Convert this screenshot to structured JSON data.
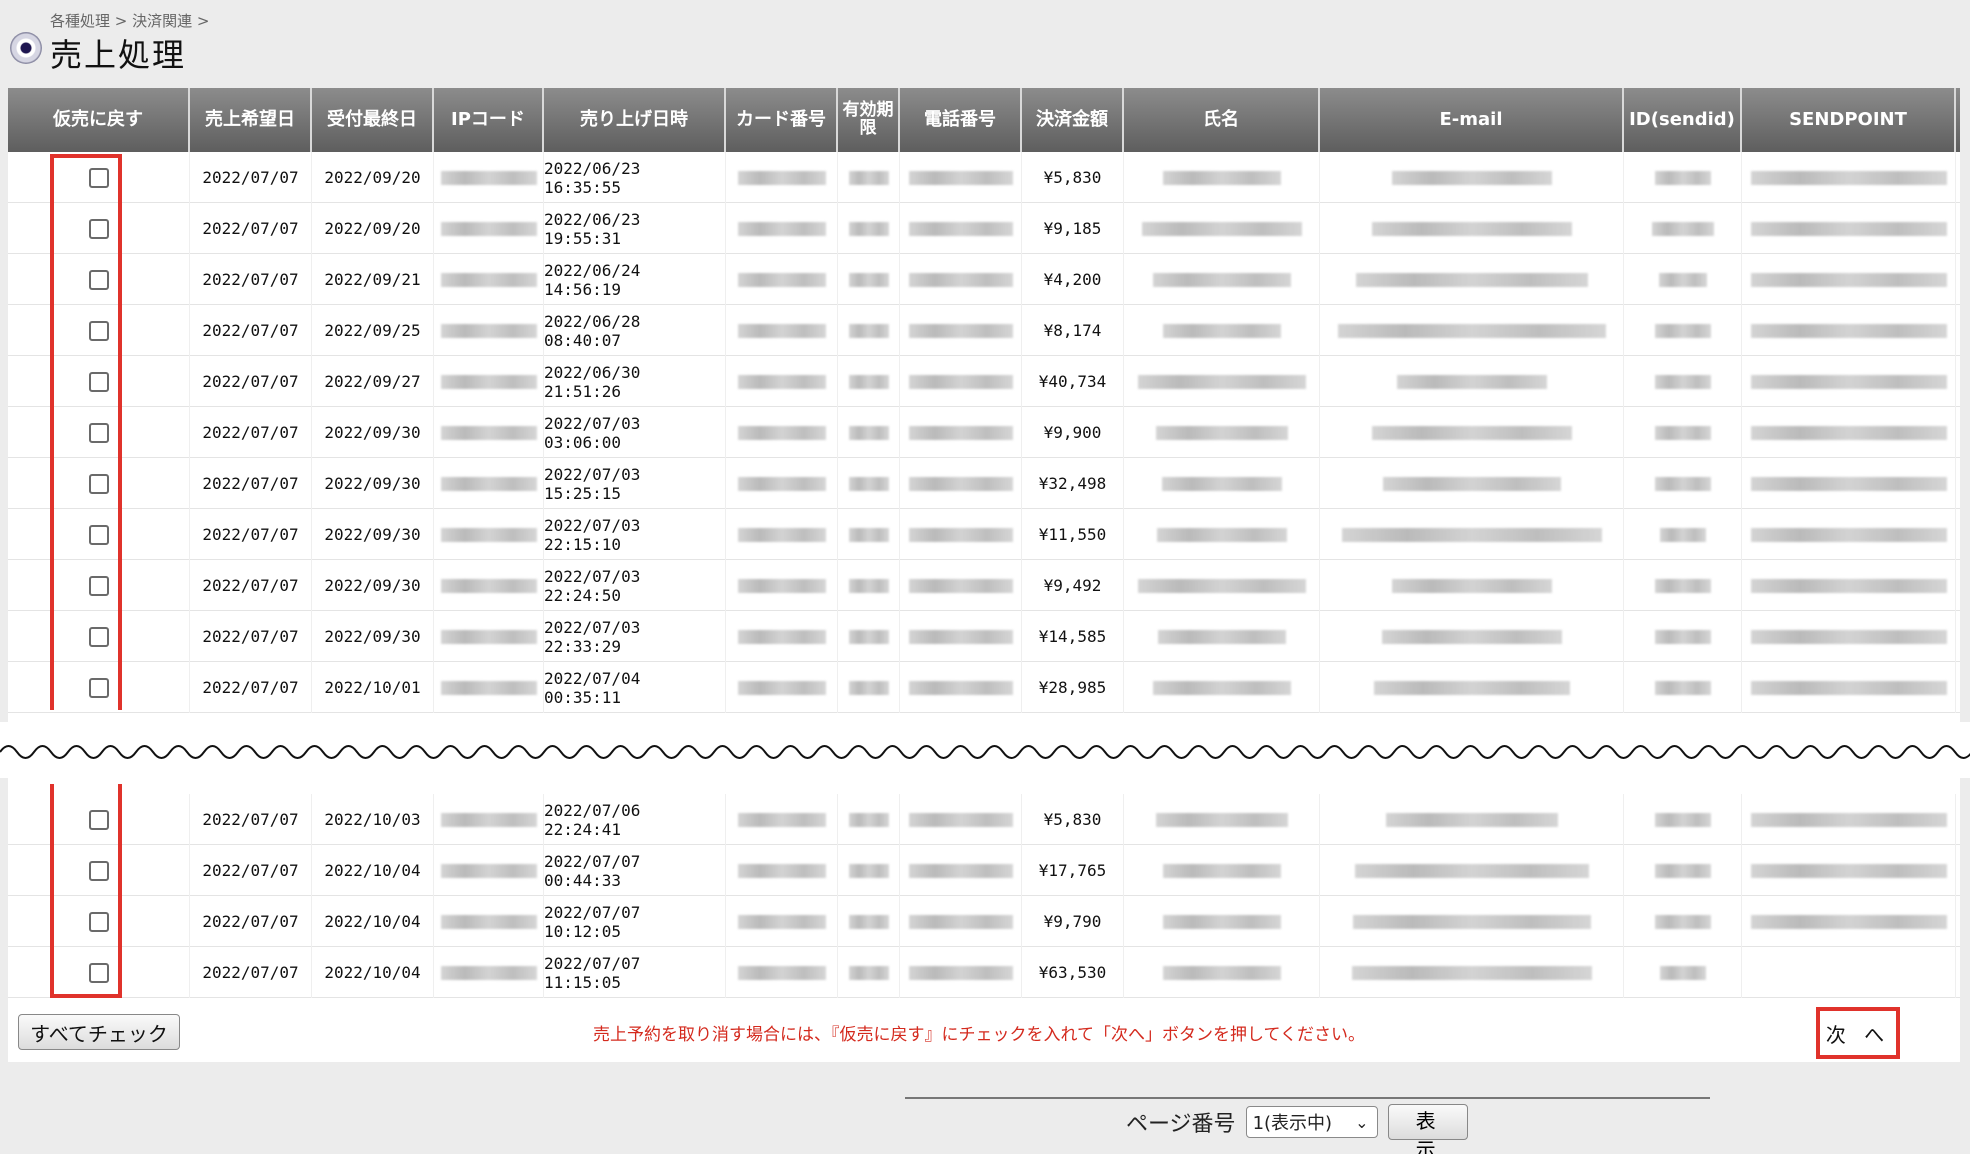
{
  "breadcrumb": "各種処理 > 決済関連 >",
  "title": "売上処理",
  "columns": [
    {
      "key": "revert",
      "label": "仮売に戻す"
    },
    {
      "key": "sale_date",
      "label": "売上希望日"
    },
    {
      "key": "deadline",
      "label": "受付最終日"
    },
    {
      "key": "ip",
      "label": "IPコード"
    },
    {
      "key": "sold_at",
      "label": "売り上げ日時"
    },
    {
      "key": "card",
      "label": "カード番号"
    },
    {
      "key": "expiry",
      "label": "有効期限"
    },
    {
      "key": "phone",
      "label": "電話番号"
    },
    {
      "key": "amount",
      "label": "決済金額"
    },
    {
      "key": "name",
      "label": "氏名"
    },
    {
      "key": "email",
      "label": "E-mail"
    },
    {
      "key": "sendid",
      "label": "ID(sendid)"
    },
    {
      "key": "sendpoint",
      "label": "SENDPOINT"
    }
  ],
  "rows_top": [
    {
      "sale_date": "2022/07/07",
      "deadline": "2022/09/20",
      "sold_at": "2022/06/23 16:35:55",
      "amount": "¥5,830"
    },
    {
      "sale_date": "2022/07/07",
      "deadline": "2022/09/20",
      "sold_at": "2022/06/23 19:55:31",
      "amount": "¥9,185"
    },
    {
      "sale_date": "2022/07/07",
      "deadline": "2022/09/21",
      "sold_at": "2022/06/24 14:56:19",
      "amount": "¥4,200"
    },
    {
      "sale_date": "2022/07/07",
      "deadline": "2022/09/25",
      "sold_at": "2022/06/28 08:40:07",
      "amount": "¥8,174"
    },
    {
      "sale_date": "2022/07/07",
      "deadline": "2022/09/27",
      "sold_at": "2022/06/30 21:51:26",
      "amount": "¥40,734"
    },
    {
      "sale_date": "2022/07/07",
      "deadline": "2022/09/30",
      "sold_at": "2022/07/03 03:06:00",
      "amount": "¥9,900"
    },
    {
      "sale_date": "2022/07/07",
      "deadline": "2022/09/30",
      "sold_at": "2022/07/03 15:25:15",
      "amount": "¥32,498"
    },
    {
      "sale_date": "2022/07/07",
      "deadline": "2022/09/30",
      "sold_at": "2022/07/03 22:15:10",
      "amount": "¥11,550"
    },
    {
      "sale_date": "2022/07/07",
      "deadline": "2022/09/30",
      "sold_at": "2022/07/03 22:24:50",
      "amount": "¥9,492"
    },
    {
      "sale_date": "2022/07/07",
      "deadline": "2022/09/30",
      "sold_at": "2022/07/03 22:33:29",
      "amount": "¥14,585"
    },
    {
      "sale_date": "2022/07/07",
      "deadline": "2022/10/01",
      "sold_at": "2022/07/04 00:35:11",
      "amount": "¥28,985"
    }
  ],
  "rows_bottom": [
    {
      "sale_date": "2022/07/07",
      "deadline": "2022/10/03",
      "sold_at": "2022/07/06 22:24:41",
      "amount": "¥5,830"
    },
    {
      "sale_date": "2022/07/07",
      "deadline": "2022/10/04",
      "sold_at": "2022/07/07 00:44:33",
      "amount": "¥17,765"
    },
    {
      "sale_date": "2022/07/07",
      "deadline": "2022/10/04",
      "sold_at": "2022/07/07 10:12:05",
      "amount": "¥9,790"
    },
    {
      "sale_date": "2022/07/07",
      "deadline": "2022/10/04",
      "sold_at": "2022/07/07 11:15:05",
      "amount": "¥63,530"
    }
  ],
  "footer": {
    "check_all_label": "すべてチェック",
    "hint": "売上予約を取り消す場合には、『仮売に戻す』にチェックを入れて「次へ」ボタンを押してください。",
    "next_label": "次 へ"
  },
  "pager": {
    "label": "ページ番号",
    "selected": "1(表示中)",
    "show_label": "表 示"
  },
  "colors": {
    "header_bg": "#6f6f6f",
    "highlight": "#e0322b",
    "hint_text": "#d42a1e"
  }
}
